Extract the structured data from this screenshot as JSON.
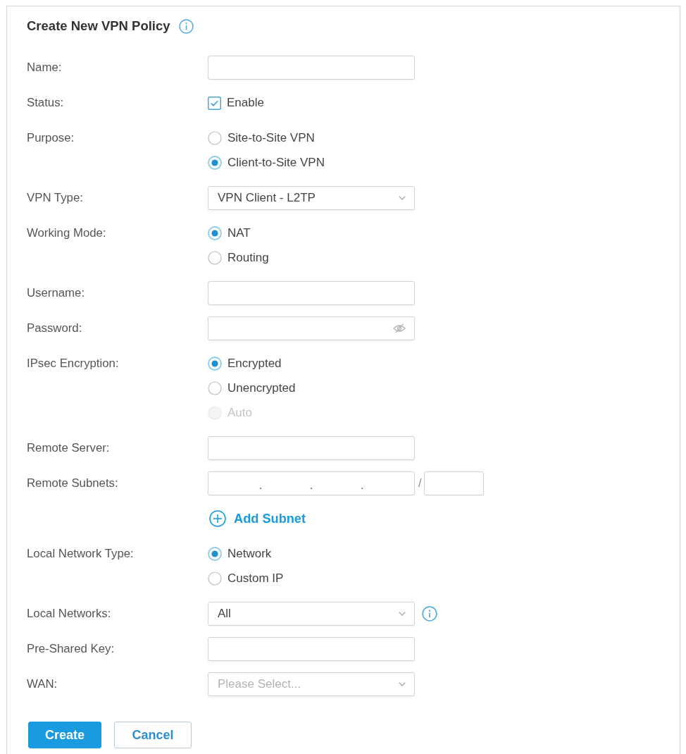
{
  "header": {
    "title": "Create New VPN Policy",
    "info": true
  },
  "fields": [
    {
      "label": "Name:",
      "kind": "text"
    },
    {
      "label": "Status:",
      "kind": "checkbox",
      "option": "Enable",
      "checked": true
    },
    {
      "label": "Purpose:",
      "kind": "radio",
      "options": [
        {
          "label": "Site-to-Site VPN",
          "selected": false,
          "disabled": false
        },
        {
          "label": "Client-to-Site VPN",
          "selected": true,
          "disabled": false
        }
      ]
    },
    {
      "label": "VPN Type:",
      "kind": "select",
      "value": "VPN Client - L2TP"
    },
    {
      "label": "Working Mode:",
      "kind": "radio",
      "options": [
        {
          "label": "NAT",
          "selected": true,
          "disabled": false
        },
        {
          "label": "Routing",
          "selected": false,
          "disabled": false
        }
      ]
    },
    {
      "label": "Username:",
      "kind": "text"
    },
    {
      "label": "Password:",
      "kind": "password"
    },
    {
      "label": "IPsec Encryption:",
      "kind": "radio",
      "options": [
        {
          "label": "Encrypted",
          "selected": true,
          "disabled": false
        },
        {
          "label": "Unencrypted",
          "selected": false,
          "disabled": false
        },
        {
          "label": "Auto",
          "selected": false,
          "disabled": true
        }
      ]
    },
    {
      "label": "Remote Server:",
      "kind": "text"
    },
    {
      "label": "Remote Subnets:",
      "kind": "subnet",
      "octet_separators": [
        ".",
        ".",
        "."
      ],
      "prefix_separator": "/"
    },
    {
      "kind": "action",
      "text": "Add Subnet"
    },
    {
      "label": "Local Network Type:",
      "kind": "radio",
      "options": [
        {
          "label": "Network",
          "selected": true,
          "disabled": false
        },
        {
          "label": "Custom IP",
          "selected": false,
          "disabled": false
        }
      ]
    },
    {
      "label": "Local Networks:",
      "kind": "select",
      "value": "All",
      "info": true
    },
    {
      "label": "Pre-Shared Key:",
      "kind": "text"
    },
    {
      "label": "WAN:",
      "kind": "select",
      "placeholder": "Please Select..."
    }
  ],
  "buttons": [
    {
      "label": "Create",
      "kind": "primary"
    },
    {
      "label": "Cancel",
      "kind": "secondary"
    }
  ]
}
